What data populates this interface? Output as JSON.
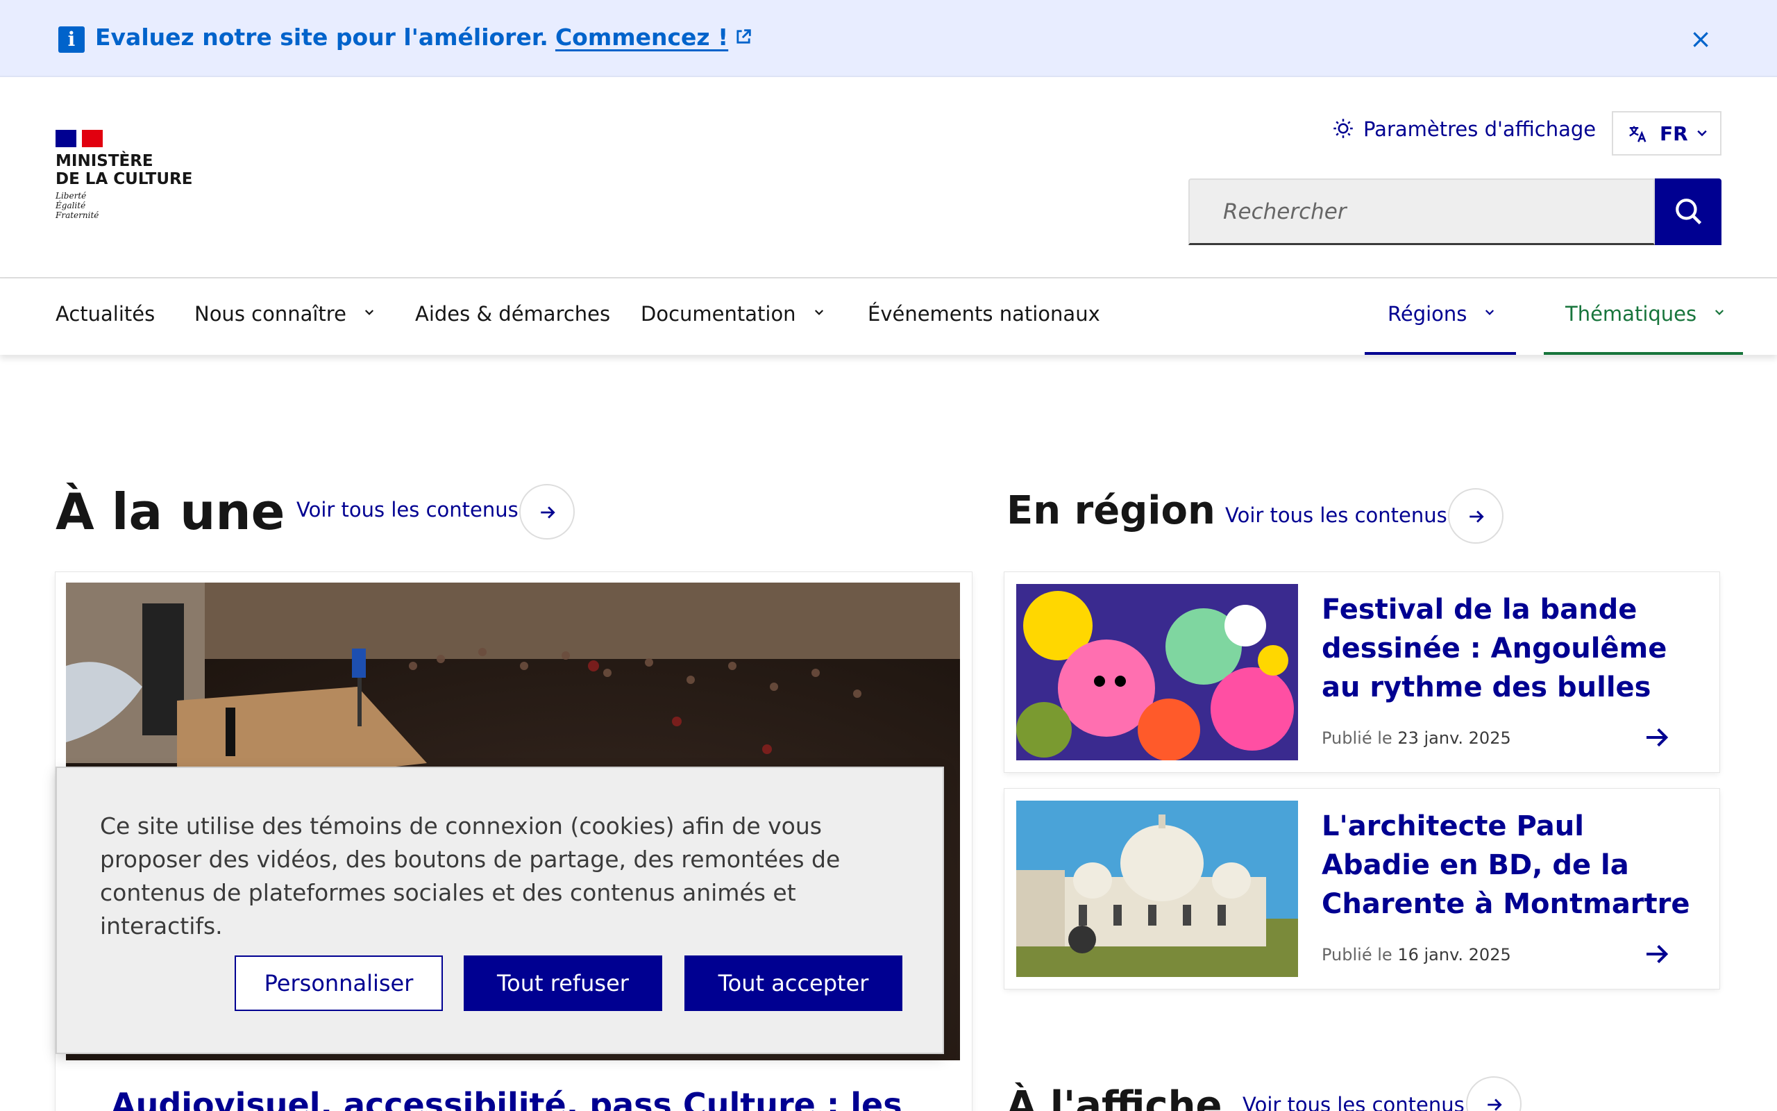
{
  "notice": {
    "text": "Evaluez notre site pour l'améliorer.",
    "link": "Commencez !",
    "close": "×"
  },
  "header": {
    "logo_line1": "MINISTÈRE",
    "logo_line2": "DE LA CULTURE",
    "motto": [
      "Liberté",
      "Égalité",
      "Fraternité"
    ],
    "display_settings": "Paramètres d'affichage",
    "language": "FR",
    "search_placeholder": "Rechercher"
  },
  "nav": {
    "items": [
      "Actualités",
      "Nous connaître",
      "Aides & démarches",
      "Documentation",
      "Événements nationaux"
    ],
    "regions": "Régions",
    "themes": "Thématiques"
  },
  "main": {
    "title": "À la une",
    "see_all": "Voir tous les contenus",
    "feature_title": "Audiovisuel, accessibilité, pass Culture : les"
  },
  "region": {
    "title": "En région",
    "see_all": "Voir tous les contenus",
    "cards": [
      {
        "title": "Festival de la bande dessinée : Angoulême au rythme des bulles",
        "prefix": "Publié le",
        "date": "23 janv. 2025"
      },
      {
        "title": "L'architecte Paul Abadie en BD, de la Charente à Montmartre",
        "prefix": "Publié le",
        "date": "16 janv. 2025"
      }
    ]
  },
  "poster": {
    "title": "À l'affiche",
    "see_all": "Voir tous les contenus"
  },
  "cookie": {
    "text": "Ce site utilise des témoins de connexion (cookies) afin de vous proposer des vidéos, des boutons de partage, des remontées de contenus de plateformes sociales et des contenus animés et interactifs.",
    "customize": "Personnaliser",
    "refuse": "Tout refuser",
    "accept": "Tout accepter"
  },
  "colors": {
    "primary": "#000091",
    "info": "#0063cb",
    "theme_green": "#18753c",
    "flag_red": "#e1000f"
  }
}
